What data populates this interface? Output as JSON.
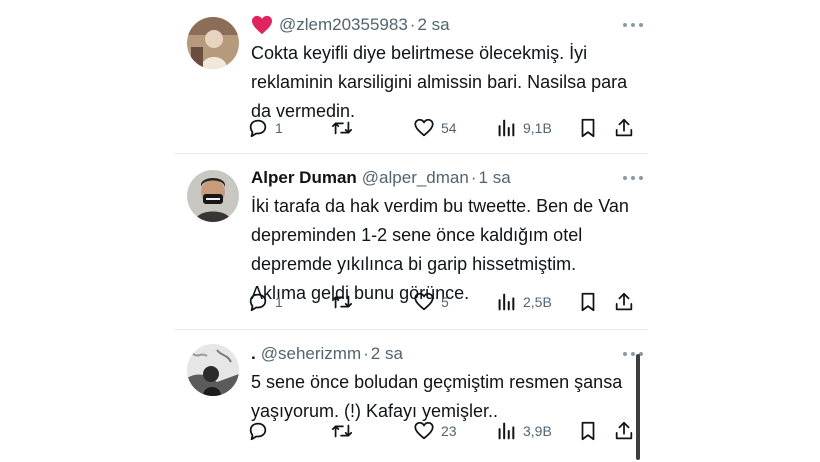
{
  "tweets": [
    {
      "name": "",
      "handle": "@zlem20355983",
      "time": "2 sa",
      "has_heart": true,
      "lines": [
        "Cokta keyifli diye belirtmese ölecekmiş. İyi",
        "reklaminin karsiligini almissin bari. Nasilsa para",
        "da vermedin."
      ],
      "replies": "1",
      "retweets": "",
      "likes": "54",
      "views": "9,1B"
    },
    {
      "name": "Alper Duman",
      "handle": "@alper_dman",
      "time": "1 sa",
      "has_heart": false,
      "lines": [
        "İki tarafa da hak verdim bu tweette. Ben de Van",
        "depreminden 1-2 sene önce kaldığım otel",
        "depremde yıkılınca bi garip hissetmiştim.",
        "Aklıma geldi bunu görünce."
      ],
      "replies": "1",
      "retweets": "",
      "likes": "5",
      "views": "2,5B"
    },
    {
      "name": ".",
      "handle": "@seherizmm",
      "time": "2 sa",
      "has_heart": false,
      "lines": [
        "5 sene önce boludan geçmiştim resmen şansa",
        "yaşıyorum. (!) Kafayı yemişler.."
      ],
      "replies": "",
      "retweets": "",
      "likes": "23",
      "views": "3,9B"
    }
  ],
  "separator": "·",
  "icons": {
    "heart_emoji": "red-heart-icon",
    "reply": "reply-icon",
    "retweet": "retweet-icon",
    "like": "like-icon",
    "views": "views-icon",
    "bookmark": "bookmark-icon",
    "share": "share-icon",
    "more": "more-icon"
  },
  "colors": {
    "text": "#0f1419",
    "secondary": "#536471",
    "divider": "#e4e7ea",
    "heart": "#e0245e"
  }
}
